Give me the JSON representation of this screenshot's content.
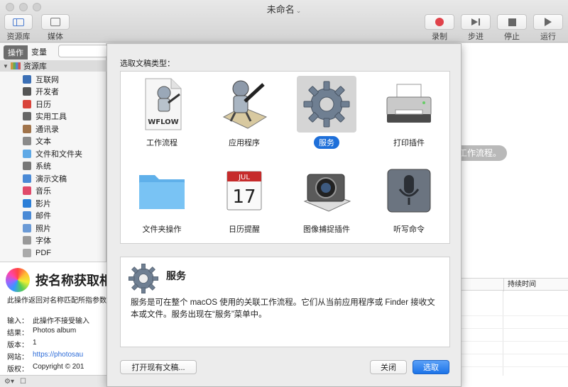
{
  "window": {
    "title": "未命名",
    "title_chevron": "⌄"
  },
  "toolbar": {
    "library_label": "资源库",
    "media_label": "媒体",
    "record_label": "录制",
    "step_label": "步进",
    "stop_label": "停止",
    "run_label": "运行"
  },
  "sidebar": {
    "tab_actions": "操作",
    "tab_variables": "变量",
    "tree_root": "资源库",
    "items": [
      {
        "label": "互联网",
        "icon": "globe-icon",
        "color": "#3b6fb5"
      },
      {
        "label": "开发者",
        "icon": "tools-icon",
        "color": "#555555"
      },
      {
        "label": "日历",
        "icon": "calendar-icon",
        "color": "#d9443b"
      },
      {
        "label": "实用工具",
        "icon": "utilities-icon",
        "color": "#666666"
      },
      {
        "label": "通讯录",
        "icon": "contacts-icon",
        "color": "#a0734a"
      },
      {
        "label": "文本",
        "icon": "text-icon",
        "color": "#8a8a8a"
      },
      {
        "label": "文件和文件夹",
        "icon": "folder-icon",
        "color": "#5fa9e6"
      },
      {
        "label": "系统",
        "icon": "system-icon",
        "color": "#777777"
      },
      {
        "label": "演示文稿",
        "icon": "presentation-icon",
        "color": "#4a8ad6"
      },
      {
        "label": "音乐",
        "icon": "music-icon",
        "color": "#e04a6a"
      },
      {
        "label": "影片",
        "icon": "movie-icon",
        "color": "#2c7fd8"
      },
      {
        "label": "邮件",
        "icon": "mail-icon",
        "color": "#4a8ad6"
      },
      {
        "label": "照片",
        "icon": "photos-icon",
        "color": "#6a9ad6"
      },
      {
        "label": "字体",
        "icon": "font-icon",
        "color": "#999999"
      },
      {
        "label": "PDF",
        "icon": "pdf-icon",
        "color": "#aaaaaa"
      }
    ]
  },
  "info": {
    "title": "按名称获取相",
    "description": "此操作返回对名称匹配所指参数",
    "rows": [
      {
        "key": "输入：",
        "value": "此操作不接受输入"
      },
      {
        "key": "结果：",
        "value": "Photos album"
      },
      {
        "key": "版本：",
        "value": "1"
      },
      {
        "key": "网站：",
        "value": "https://photosau"
      },
      {
        "key": "版权：",
        "value": "Copyright © 201"
      }
    ]
  },
  "workflow": {
    "hint": "工作流程。",
    "log_duration_header": "持续时间"
  },
  "dialog": {
    "prompt": "选取文稿类型：",
    "types": [
      {
        "label": "工作流程",
        "icon": "workflow-document-icon",
        "selected": false
      },
      {
        "label": "应用程序",
        "icon": "application-robot-icon",
        "selected": false
      },
      {
        "label": "服务",
        "icon": "service-gear-icon",
        "selected": true
      },
      {
        "label": "打印插件",
        "icon": "print-plugin-icon",
        "selected": false
      },
      {
        "label": "文件夹操作",
        "icon": "folder-action-icon",
        "selected": false
      },
      {
        "label": "日历提醒",
        "icon": "calendar-alarm-icon",
        "selected": false
      },
      {
        "label": "图像捕捉插件",
        "icon": "image-capture-icon",
        "selected": false
      },
      {
        "label": "听写命令",
        "icon": "dictation-mic-icon",
        "selected": false
      }
    ],
    "wflow_badge": "WFLOW",
    "calendar_month": "JUL",
    "calendar_day": "17",
    "selected_title": "服务",
    "selected_description": "服务是可在整个 macOS 使用的关联工作流程。它们从当前应用程序或 Finder 接收文本或文件。服务出现在“服务”菜单中。",
    "open_existing_label": "打开现有文稿...",
    "close_label": "关闭",
    "choose_label": "选取"
  }
}
